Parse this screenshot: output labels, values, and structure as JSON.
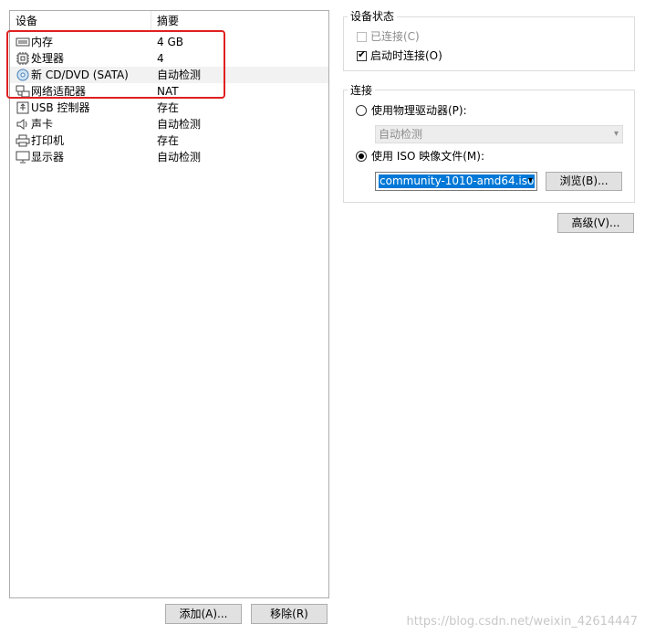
{
  "device_list": {
    "columns": {
      "device": "设备",
      "summary": "摘要"
    },
    "rows": [
      {
        "name": "内存",
        "summary": "4 GB",
        "icon": "memory-icon"
      },
      {
        "name": "处理器",
        "summary": "4",
        "icon": "cpu-icon"
      },
      {
        "name": "新 CD/DVD (SATA)",
        "summary": "自动检测",
        "icon": "disc-icon"
      },
      {
        "name": "网络适配器",
        "summary": "NAT",
        "icon": "network-icon"
      },
      {
        "name": "USB 控制器",
        "summary": "存在",
        "icon": "usb-icon"
      },
      {
        "name": "声卡",
        "summary": "自动检测",
        "icon": "speaker-icon"
      },
      {
        "name": "打印机",
        "summary": "存在",
        "icon": "printer-icon"
      },
      {
        "name": "显示器",
        "summary": "自动检测",
        "icon": "monitor-icon"
      }
    ]
  },
  "buttons": {
    "add": "添加(A)...",
    "remove": "移除(R)",
    "advanced": "高级(V)...",
    "browse": "浏览(B)..."
  },
  "device_status": {
    "title": "设备状态",
    "connected": {
      "label": "已连接(C)",
      "checked": false,
      "enabled": false
    },
    "connect_on_start": {
      "label": "启动时连接(O)",
      "checked": true
    }
  },
  "connection": {
    "title": "连接",
    "use_physical": "使用物理驱动器(P):",
    "physical_value": "自动检测",
    "use_iso": "使用 ISO 映像文件(M):",
    "iso_value": "community-1010-amd64.iso"
  },
  "watermark": "https://blog.csdn.net/weixin_42614447",
  "colors": {
    "highlight_box": "#e02020",
    "selection": "#0078d7"
  }
}
